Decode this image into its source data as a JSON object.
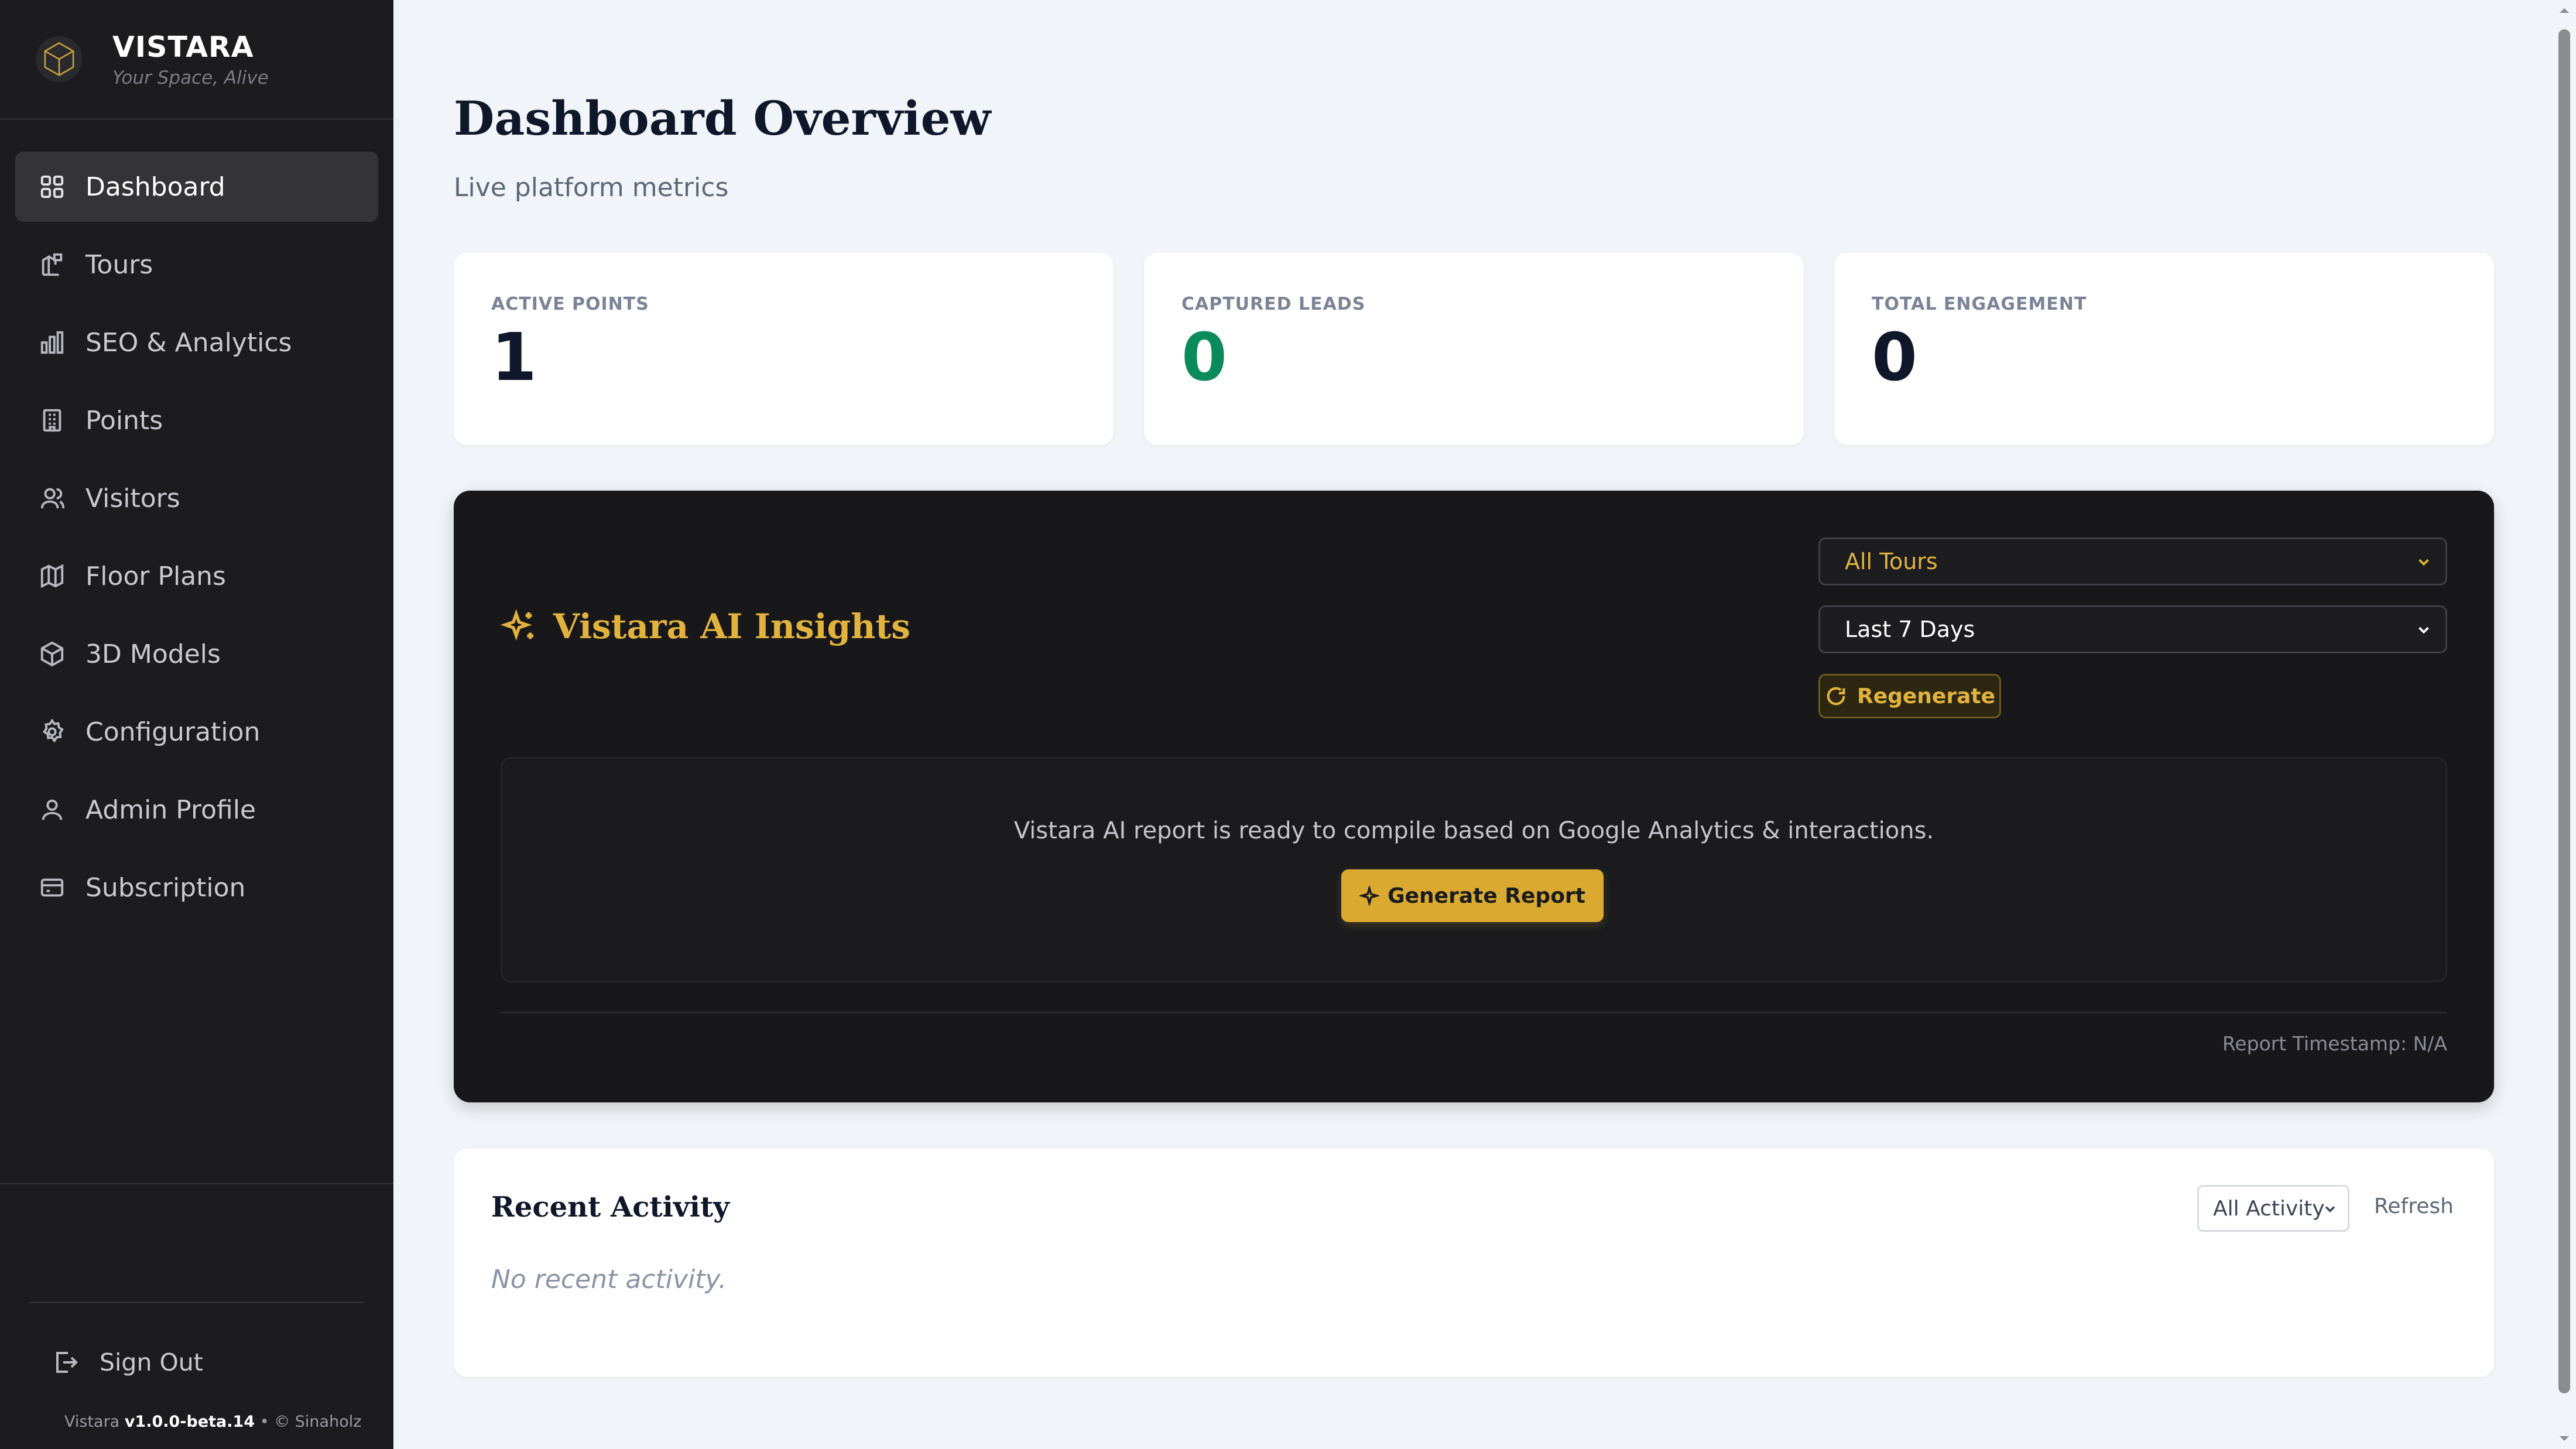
{
  "brand": {
    "name": "VISTARA",
    "tagline": "Your Space, Alive"
  },
  "sidebar": {
    "items": [
      {
        "label": "Dashboard",
        "icon": "grid-icon",
        "active": true
      },
      {
        "label": "Tours",
        "icon": "tour-icon"
      },
      {
        "label": "SEO & Analytics",
        "icon": "bar-chart-icon"
      },
      {
        "label": "Points",
        "icon": "building-icon"
      },
      {
        "label": "Visitors",
        "icon": "users-icon"
      },
      {
        "label": "Floor Plans",
        "icon": "map-icon"
      },
      {
        "label": "3D Models",
        "icon": "cube-icon"
      },
      {
        "label": "Configuration",
        "icon": "gear-icon"
      },
      {
        "label": "Admin Profile",
        "icon": "user-icon"
      },
      {
        "label": "Subscription",
        "icon": "card-icon"
      }
    ],
    "signout_label": "Sign Out",
    "version_prefix": "Vistara",
    "version": "v1.0.0-beta.14",
    "copyright": "• © Sinaholz"
  },
  "page": {
    "title": "Dashboard Overview",
    "subtitle": "Live platform metrics"
  },
  "stats": [
    {
      "label": "ACTIVE POINTS",
      "value": "1"
    },
    {
      "label": "CAPTURED LEADS",
      "value": "0"
    },
    {
      "label": "TOTAL ENGAGEMENT",
      "value": "0"
    }
  ],
  "ai": {
    "title": "Vistara AI Insights",
    "tour_filter": "All Tours",
    "range_filter": "Last 7 Days",
    "regenerate_label": "Regenerate",
    "message": "Vistara AI report is ready to compile based on Google Analytics & interactions.",
    "generate_label": "Generate Report",
    "timestamp": "Report Timestamp: N/A"
  },
  "activity": {
    "title": "Recent Activity",
    "filter": "All Activity",
    "refresh_label": "Refresh",
    "empty": "No recent activity."
  },
  "colors": {
    "accent_gold": "#e2b33c",
    "leads_green": "#0b8a5c",
    "sidebar_bg": "#1c1c1f"
  }
}
